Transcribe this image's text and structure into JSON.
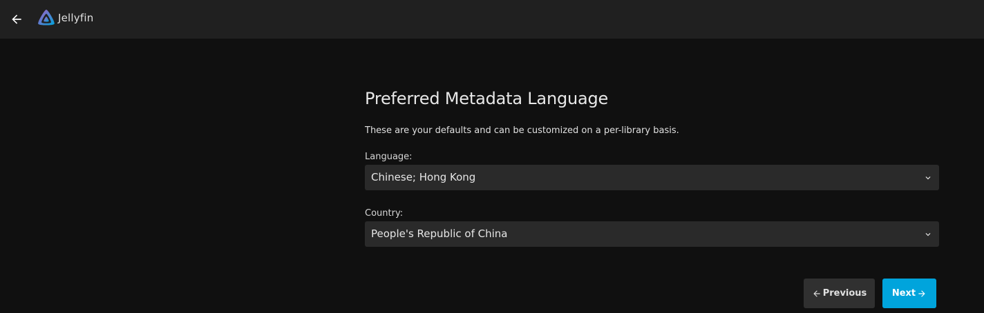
{
  "app": {
    "title": "Jellyfin",
    "back_icon": "arrow-left-icon",
    "logo_icon": "jellyfin-logo"
  },
  "wizard": {
    "title": "Preferred Metadata Language",
    "description": "These are your defaults and can be customized on a per-library basis.",
    "language_label": "Language:",
    "language_value": "Chinese; Hong Kong",
    "country_label": "Country:",
    "country_value": "People's Republic of China",
    "previous_label": "Previous",
    "next_label": "Next"
  },
  "colors": {
    "background": "#101010",
    "header": "#202020",
    "select_bg": "#2a2a2a",
    "accent": "#00a4dc",
    "logo_gradient_start": "#aa5cc3",
    "logo_gradient_end": "#00a4dc"
  }
}
